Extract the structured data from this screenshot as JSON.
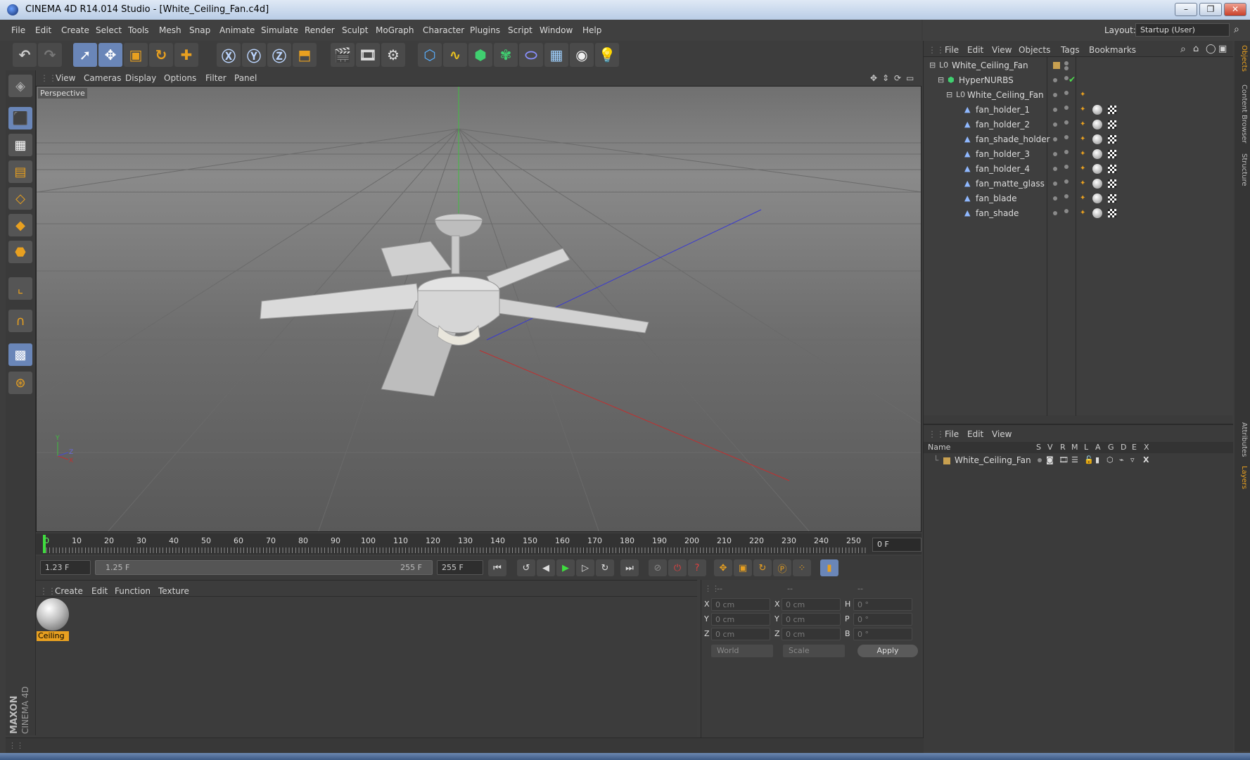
{
  "window": {
    "title": "CINEMA 4D R14.014 Studio - [White_Ceiling_Fan.c4d]",
    "minimize": "–",
    "restore": "❐",
    "close": "✕"
  },
  "menubar": [
    "File",
    "Edit",
    "Create",
    "Select",
    "Tools",
    "Mesh",
    "Snap",
    "Animate",
    "Simulate",
    "Render",
    "Sculpt",
    "MoGraph",
    "Character",
    "Plugins",
    "Script",
    "Window",
    "Help"
  ],
  "layout": {
    "label": "Layout:",
    "value": "Startup (User)"
  },
  "viewport": {
    "menu": [
      "View",
      "Cameras",
      "Display",
      "Options",
      "Filter",
      "Panel"
    ],
    "label": "Perspective",
    "axis_labels": {
      "y": "Y",
      "z": "Z",
      "x": "X"
    }
  },
  "timeline": {
    "ticks": [
      "0",
      "10",
      "20",
      "30",
      "40",
      "50",
      "60",
      "70",
      "80",
      "90",
      "100",
      "110",
      "120",
      "130",
      "140",
      "150",
      "160",
      "170",
      "180",
      "190",
      "200",
      "210",
      "220",
      "230",
      "240",
      "250"
    ],
    "current_frame": "0 F"
  },
  "transport": {
    "start": "1.23 F",
    "range_start": "1.25 F",
    "range_end": "255 F",
    "end": "255 F"
  },
  "material_panel": {
    "menu": [
      "Create",
      "Edit",
      "Function",
      "Texture"
    ],
    "material_name": "Ceiling"
  },
  "coordinates": {
    "headers": [
      "--",
      "--",
      "--"
    ],
    "rows": [
      {
        "a": "X",
        "v1": "0 cm",
        "b": "X",
        "v2": "0 cm",
        "c": "H",
        "v3": "0 °"
      },
      {
        "a": "Y",
        "v1": "0 cm",
        "b": "Y",
        "v2": "0 cm",
        "c": "P",
        "v3": "0 °"
      },
      {
        "a": "Z",
        "v1": "0 cm",
        "b": "Z",
        "v2": "0 cm",
        "c": "B",
        "v3": "0 °"
      }
    ],
    "mode1": "World",
    "mode2": "Scale",
    "apply": "Apply"
  },
  "object_manager": {
    "menu": [
      "File",
      "Edit",
      "View",
      "Objects",
      "Tags",
      "Bookmarks"
    ],
    "objects": [
      {
        "name": "White_Ceiling_Fan",
        "depth": 0,
        "type": "null"
      },
      {
        "name": "HyperNURBS",
        "depth": 1,
        "type": "nurbs"
      },
      {
        "name": "White_Ceiling_Fan",
        "depth": 2,
        "type": "null"
      },
      {
        "name": "fan_holder_1",
        "depth": 3,
        "type": "poly"
      },
      {
        "name": "fan_holder_2",
        "depth": 3,
        "type": "poly"
      },
      {
        "name": "fan_shade_holder",
        "depth": 3,
        "type": "poly"
      },
      {
        "name": "fan_holder_3",
        "depth": 3,
        "type": "poly"
      },
      {
        "name": "fan_holder_4",
        "depth": 3,
        "type": "poly"
      },
      {
        "name": "fan_matte_glass",
        "depth": 3,
        "type": "poly"
      },
      {
        "name": "fan_blade",
        "depth": 3,
        "type": "poly"
      },
      {
        "name": "fan_shade",
        "depth": 3,
        "type": "poly"
      }
    ]
  },
  "layer_manager": {
    "menu": [
      "File",
      "Edit",
      "View"
    ],
    "columns": [
      "Name",
      "S",
      "V",
      "R",
      "M",
      "L",
      "A",
      "G",
      "D",
      "E",
      "X"
    ],
    "layers": [
      {
        "name": "White_Ceiling_Fan"
      }
    ]
  },
  "side_tabs": [
    "Objects",
    "Content Browser",
    "Structure",
    "Attributes",
    "Layers"
  ],
  "branding": {
    "maxon": "MAXON",
    "product": "CINEMA 4D"
  },
  "colors": {
    "accent": "#e8a020",
    "selected": "#6a86b8",
    "panel": "#3c3c3c"
  }
}
